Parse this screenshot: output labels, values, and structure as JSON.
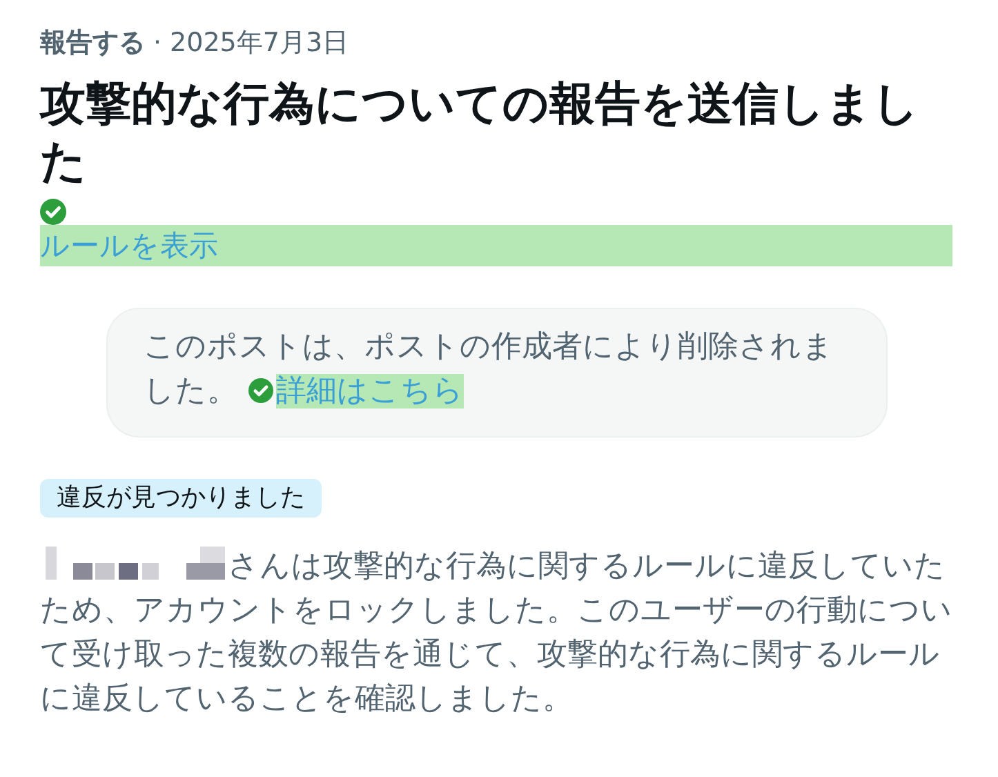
{
  "header": {
    "category": "報告する",
    "separator": "·",
    "date": "2025年7月3日"
  },
  "title": "攻撃的な行為についての報告を送信しました",
  "rules_link": {
    "label": "ルールを表示"
  },
  "notice": {
    "text": "このポストは、ポストの作成者により削除されました。",
    "link": "詳細はこちら"
  },
  "badge": "違反が見つかりました",
  "message": "さんは攻撃的な行為に関するルールに違反していたため、アカウントをロックしました。このユーザーの行動について受け取った複数の報告を通じて、攻撃的な行為に関するルールに違反していることを確認しました。"
}
